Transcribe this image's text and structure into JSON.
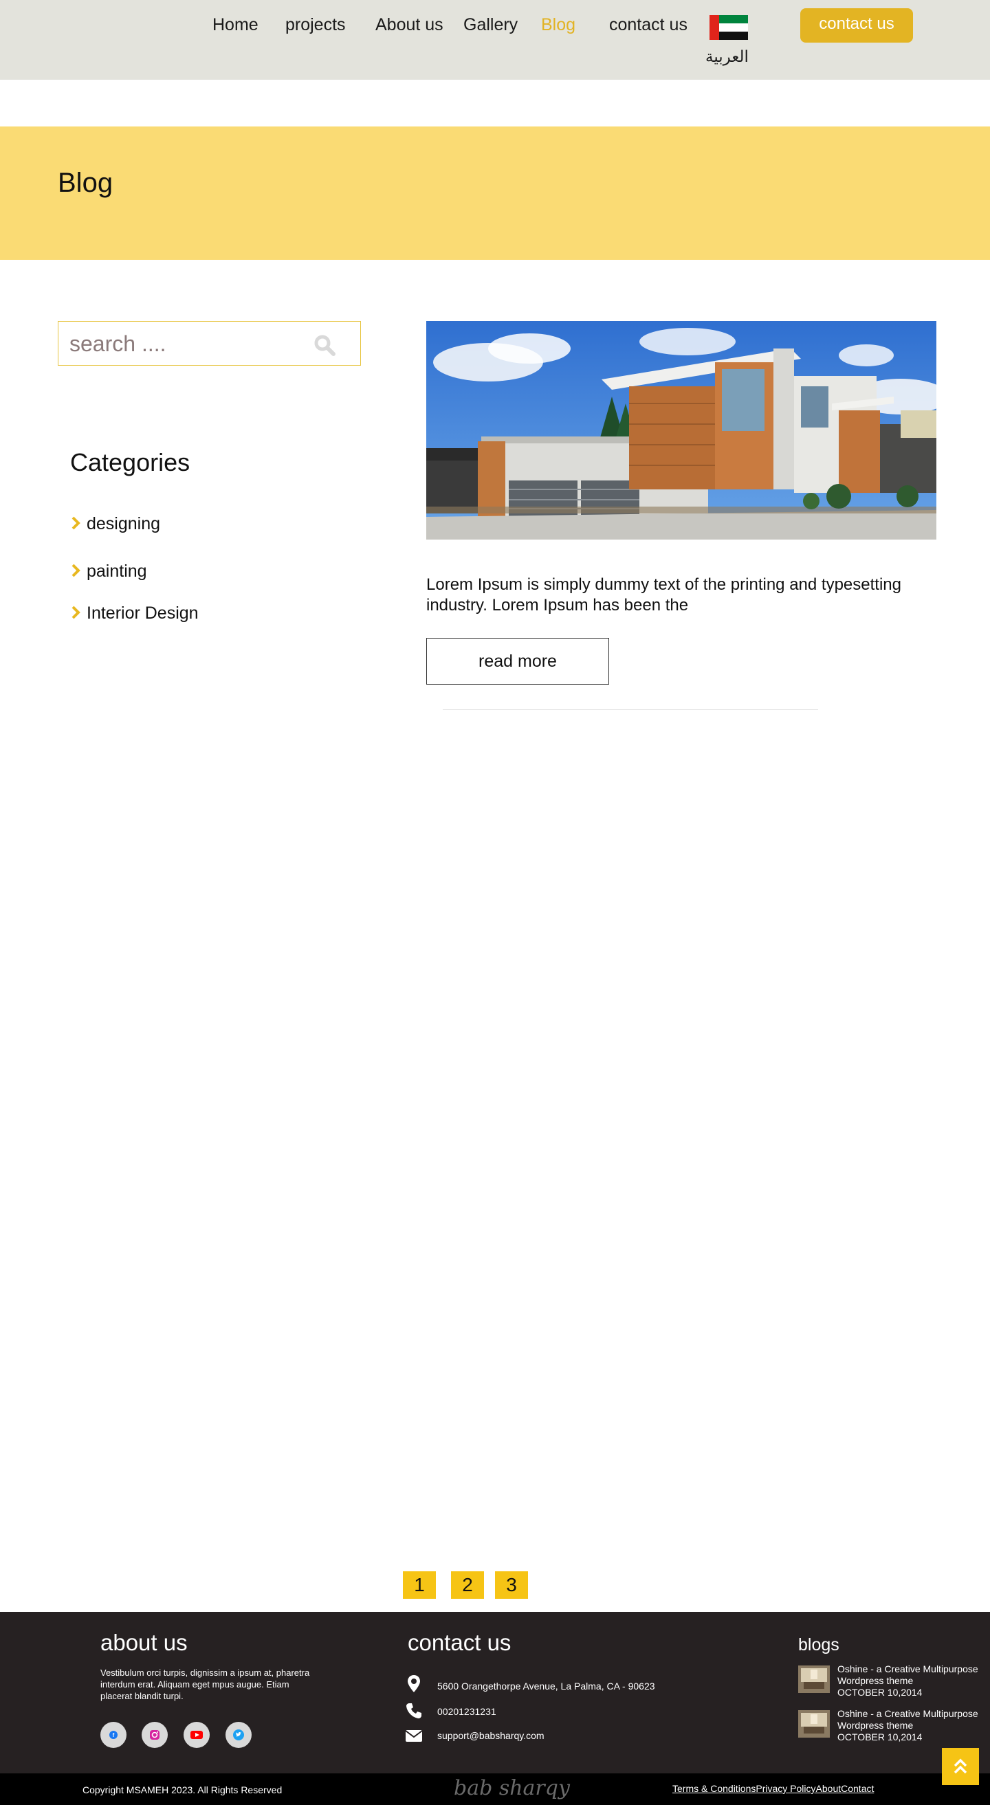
{
  "header": {
    "nav": [
      "Home",
      "projects",
      "About us",
      "Gallery",
      "Blog",
      "contact us"
    ],
    "active_item": "Blog",
    "language_label": "العربية",
    "contact_button": "contact us"
  },
  "banner": {
    "title": "Blog"
  },
  "sidebar": {
    "search_placeholder": "search ....",
    "categories_title": "Categories",
    "categories": [
      "designing",
      "painting",
      "Interior Design"
    ]
  },
  "post": {
    "excerpt": "Lorem Ipsum is simply dummy text of the printing and typesetting industry. Lorem Ipsum has been the",
    "read_more": "read more"
  },
  "pagination": [
    "1",
    "2",
    "3"
  ],
  "footer": {
    "about": {
      "title": "about us",
      "text": "Vestibulum orci turpis, dignissim a ipsum at, pharetra interdum erat. Aliquam eget mpus augue. Etiam placerat blandit turpi."
    },
    "contact": {
      "title": "contact us",
      "address": "5600 Orangethorpe Avenue, La Palma, CA - 90623",
      "phone": "00201231231",
      "email": "support@babsharqy.com"
    },
    "blogs": {
      "title": "blogs",
      "items": [
        {
          "title": "Oshine - a Creative Multipurpose Wordpress theme",
          "date": "OCTOBER 10,2014"
        },
        {
          "title": "Oshine - a Creative Multipurpose Wordpress theme",
          "date": "OCTOBER 10,2014"
        }
      ]
    },
    "copyright": "Copyright MSAMEH 2023. All Rights Reserved",
    "signature": "bab sharqy",
    "links": [
      "Terms & Conditions",
      "Privacy Policy",
      "About",
      "Contact"
    ]
  },
  "colors": {
    "accent": "#e3b423",
    "banner": "#fadb74",
    "header_bg": "#e3e3dc",
    "footer_bg": "#262122",
    "pagination": "#f6c415"
  },
  "icons": [
    "uae-flag-icon",
    "search-icon",
    "chevron-right-icon",
    "map-pin-icon",
    "phone-icon",
    "envelope-icon",
    "facebook-icon",
    "instagram-icon",
    "youtube-icon",
    "twitter-icon",
    "double-chevron-up-icon"
  ]
}
